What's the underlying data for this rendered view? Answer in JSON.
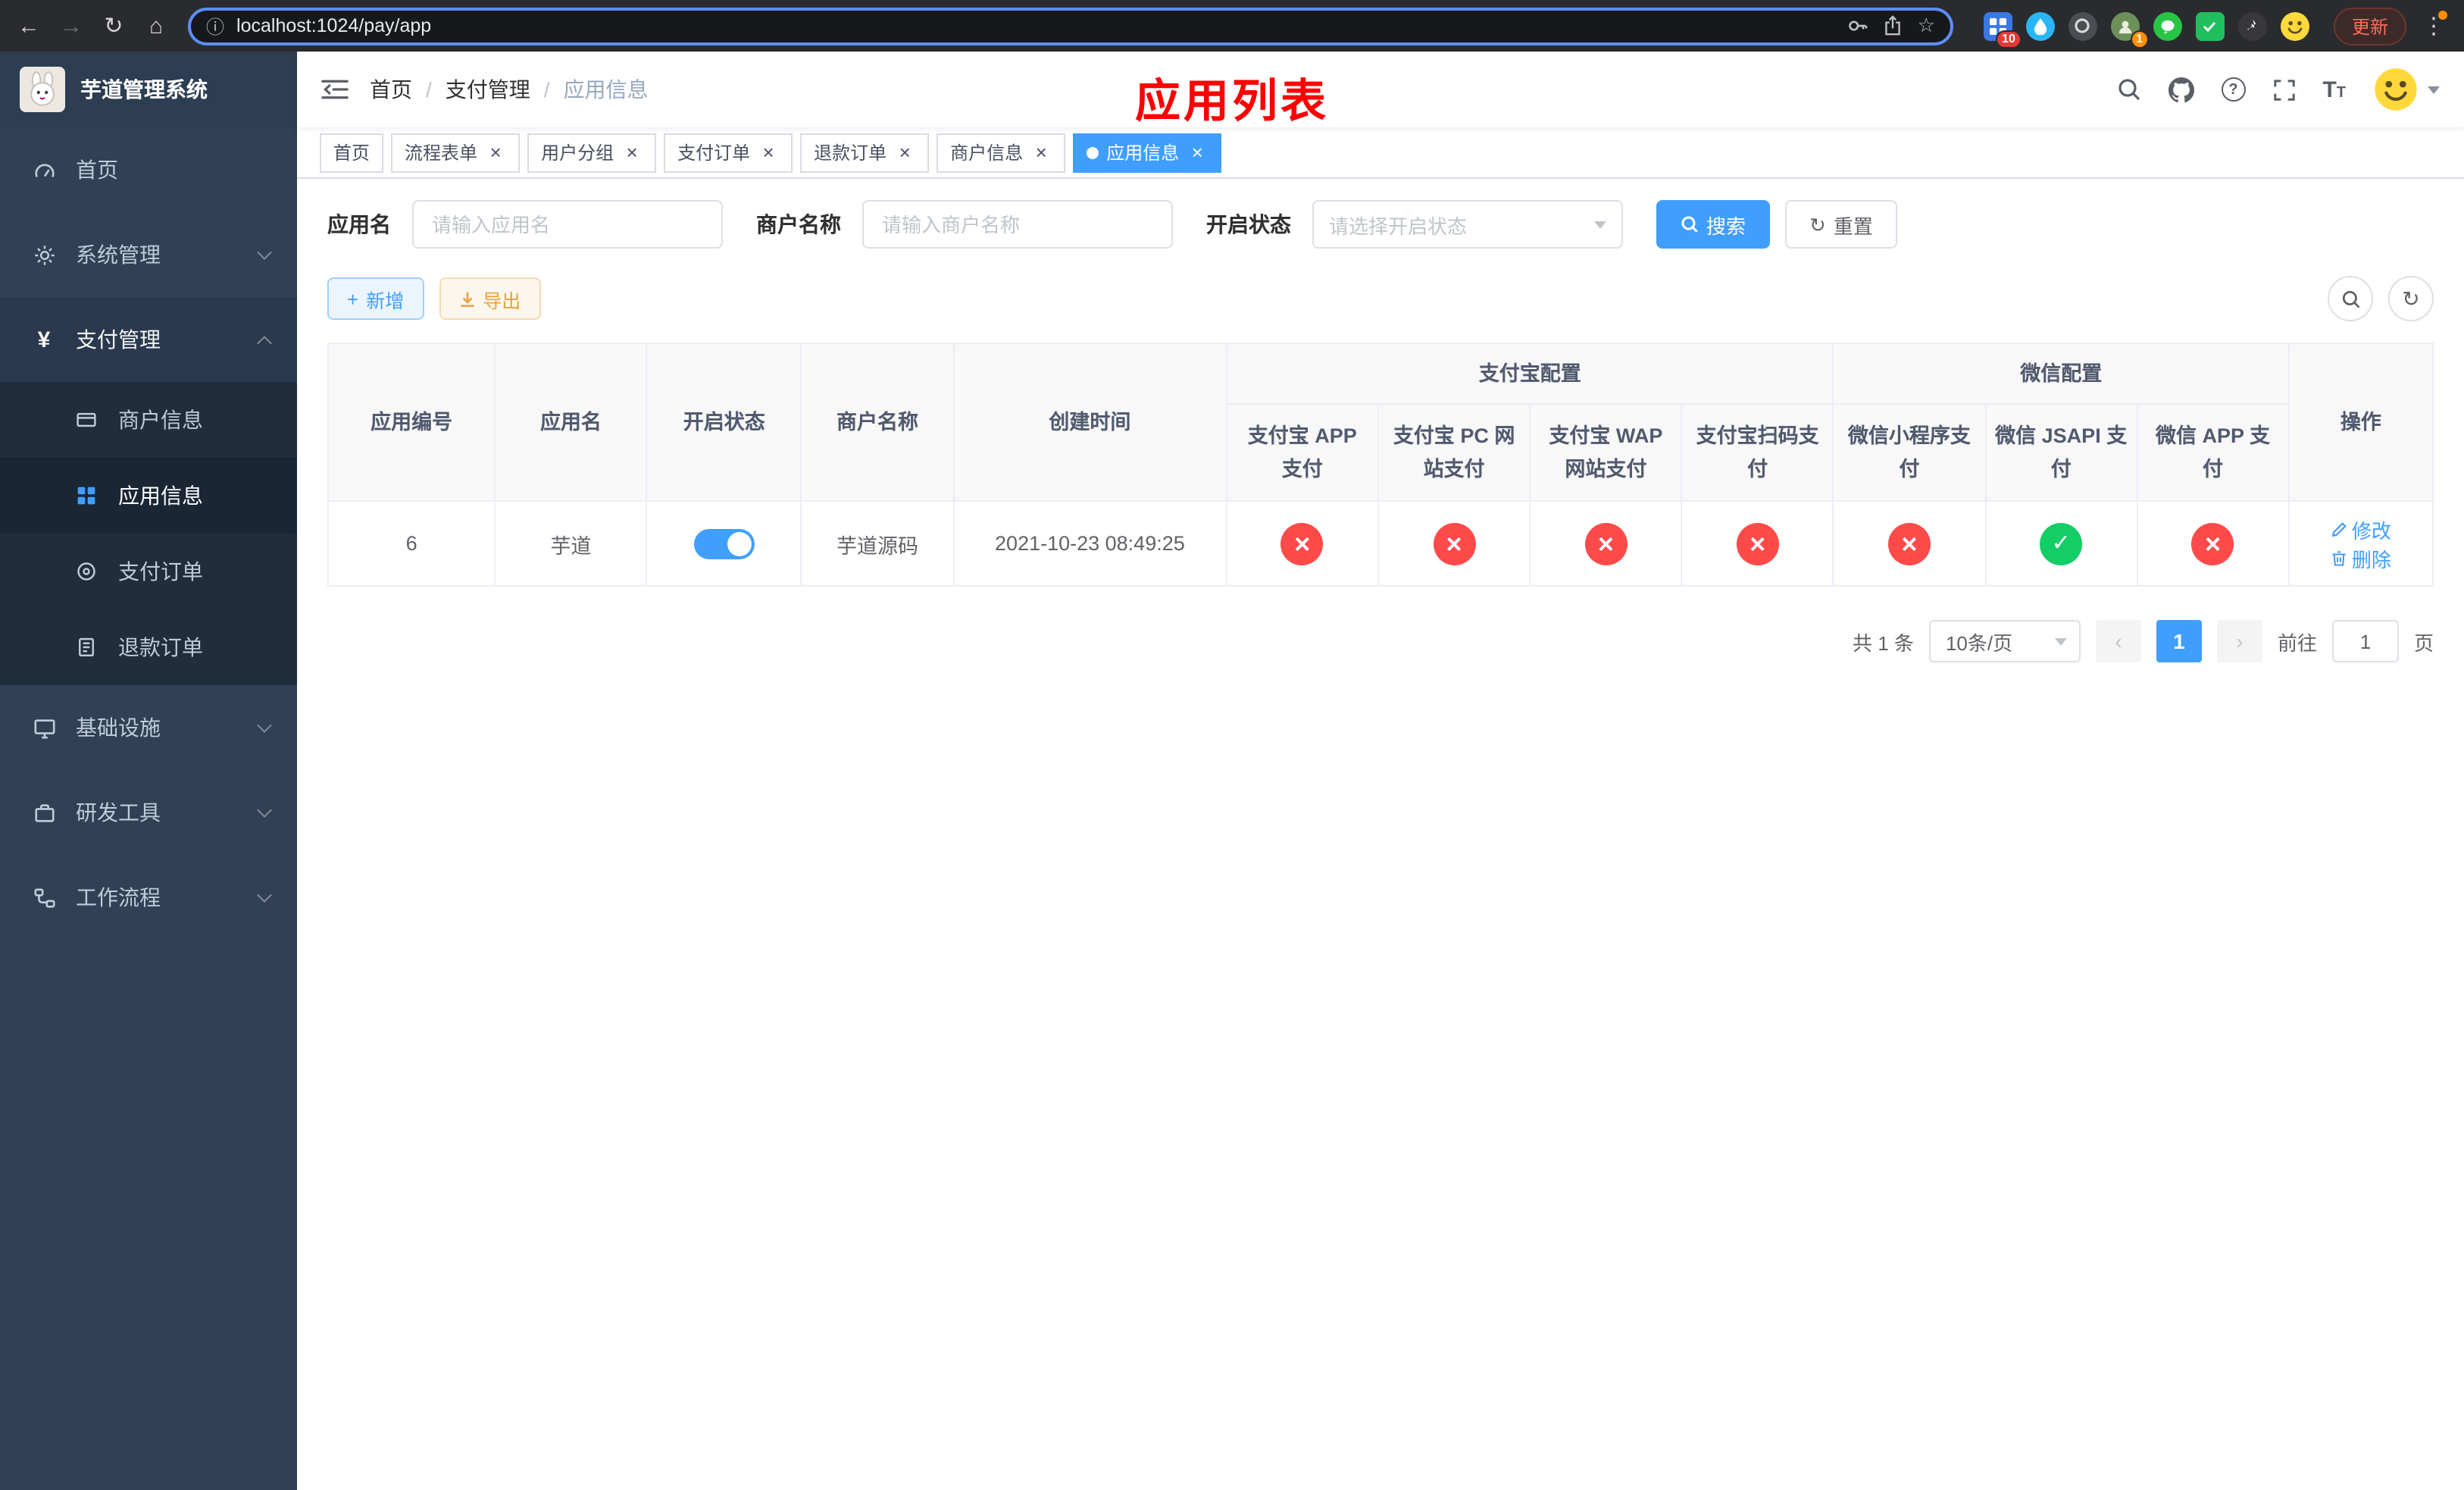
{
  "browser": {
    "url": "localhost:1024/pay/app",
    "update_button": "更新",
    "badge_extensions": "10",
    "badge_avatar": "1"
  },
  "icons": {
    "back": "←",
    "forward": "→",
    "reload": "↻",
    "home": "⌂",
    "info": "ⓘ",
    "star": "☆",
    "kebab": "⋮",
    "yen": "¥",
    "plus": "+",
    "refresh": "↻",
    "close": "×",
    "prev": "‹",
    "next": "›",
    "question": "?",
    "font_large": "T",
    "font_small": "T"
  },
  "sidebar": {
    "logo_title": "芋道管理系统",
    "menu": [
      {
        "label": "首页"
      },
      {
        "label": "系统管理"
      },
      {
        "label": "支付管理"
      },
      {
        "label": "基础设施"
      },
      {
        "label": "研发工具"
      },
      {
        "label": "工作流程"
      }
    ],
    "pay_children": [
      {
        "label": "商户信息"
      },
      {
        "label": "应用信息"
      },
      {
        "label": "支付订单"
      },
      {
        "label": "退款订单"
      }
    ]
  },
  "header": {
    "breadcrumb": [
      "首页",
      "支付管理",
      "应用信息"
    ],
    "breadcrumb_separator": "/",
    "overlay_title": "应用列表"
  },
  "tabs": [
    {
      "label": "首页",
      "closable": false,
      "active": false
    },
    {
      "label": "流程表单",
      "closable": true,
      "active": false
    },
    {
      "label": "用户分组",
      "closable": true,
      "active": false
    },
    {
      "label": "支付订单",
      "closable": true,
      "active": false
    },
    {
      "label": "退款订单",
      "closable": true,
      "active": false
    },
    {
      "label": "商户信息",
      "closable": true,
      "active": false
    },
    {
      "label": "应用信息",
      "closable": true,
      "active": true
    }
  ],
  "filters": {
    "app_name_label": "应用名",
    "app_name_placeholder": "请输入应用名",
    "merchant_label": "商户名称",
    "merchant_placeholder": "请输入商户名称",
    "status_label": "开启状态",
    "status_placeholder": "请选择开启状态",
    "search_button": "搜索",
    "reset_button": "重置"
  },
  "toolbar": {
    "add_button": "新增",
    "export_button": "导出"
  },
  "table": {
    "group_alipay": "支付宝配置",
    "group_wechat": "微信配置",
    "columns": [
      "应用编号",
      "应用名",
      "开启状态",
      "商户名称",
      "创建时间",
      "支付宝 APP 支付",
      "支付宝 PC 网站支付",
      "支付宝 WAP 网站支付",
      "支付宝扫码支付",
      "微信小程序支付",
      "微信 JSAPI 支付",
      "微信 APP 支付",
      "操作"
    ],
    "row": {
      "id": "6",
      "name": "芋道",
      "enabled": "on",
      "merchant": "芋道源码",
      "created_at": "2021-10-23 08:49:25",
      "channels": [
        "no",
        "no",
        "no",
        "no",
        "no",
        "yes",
        "no"
      ],
      "edit_label": "修改",
      "delete_label": "删除"
    }
  },
  "pagination": {
    "total": "共 1 条",
    "page_size": "10条/页",
    "page": "1",
    "goto_prefix": "前往",
    "goto_value": "1",
    "goto_suffix": "页"
  },
  "colors": {
    "primary": "#409eff",
    "success": "#13ce66",
    "danger": "#ff4a4a",
    "warning": "#e6a23c",
    "annotation_red": "#fe0000",
    "sidebar_bg": "#304156",
    "sidebar_sub_bg": "#1f2d3d"
  }
}
